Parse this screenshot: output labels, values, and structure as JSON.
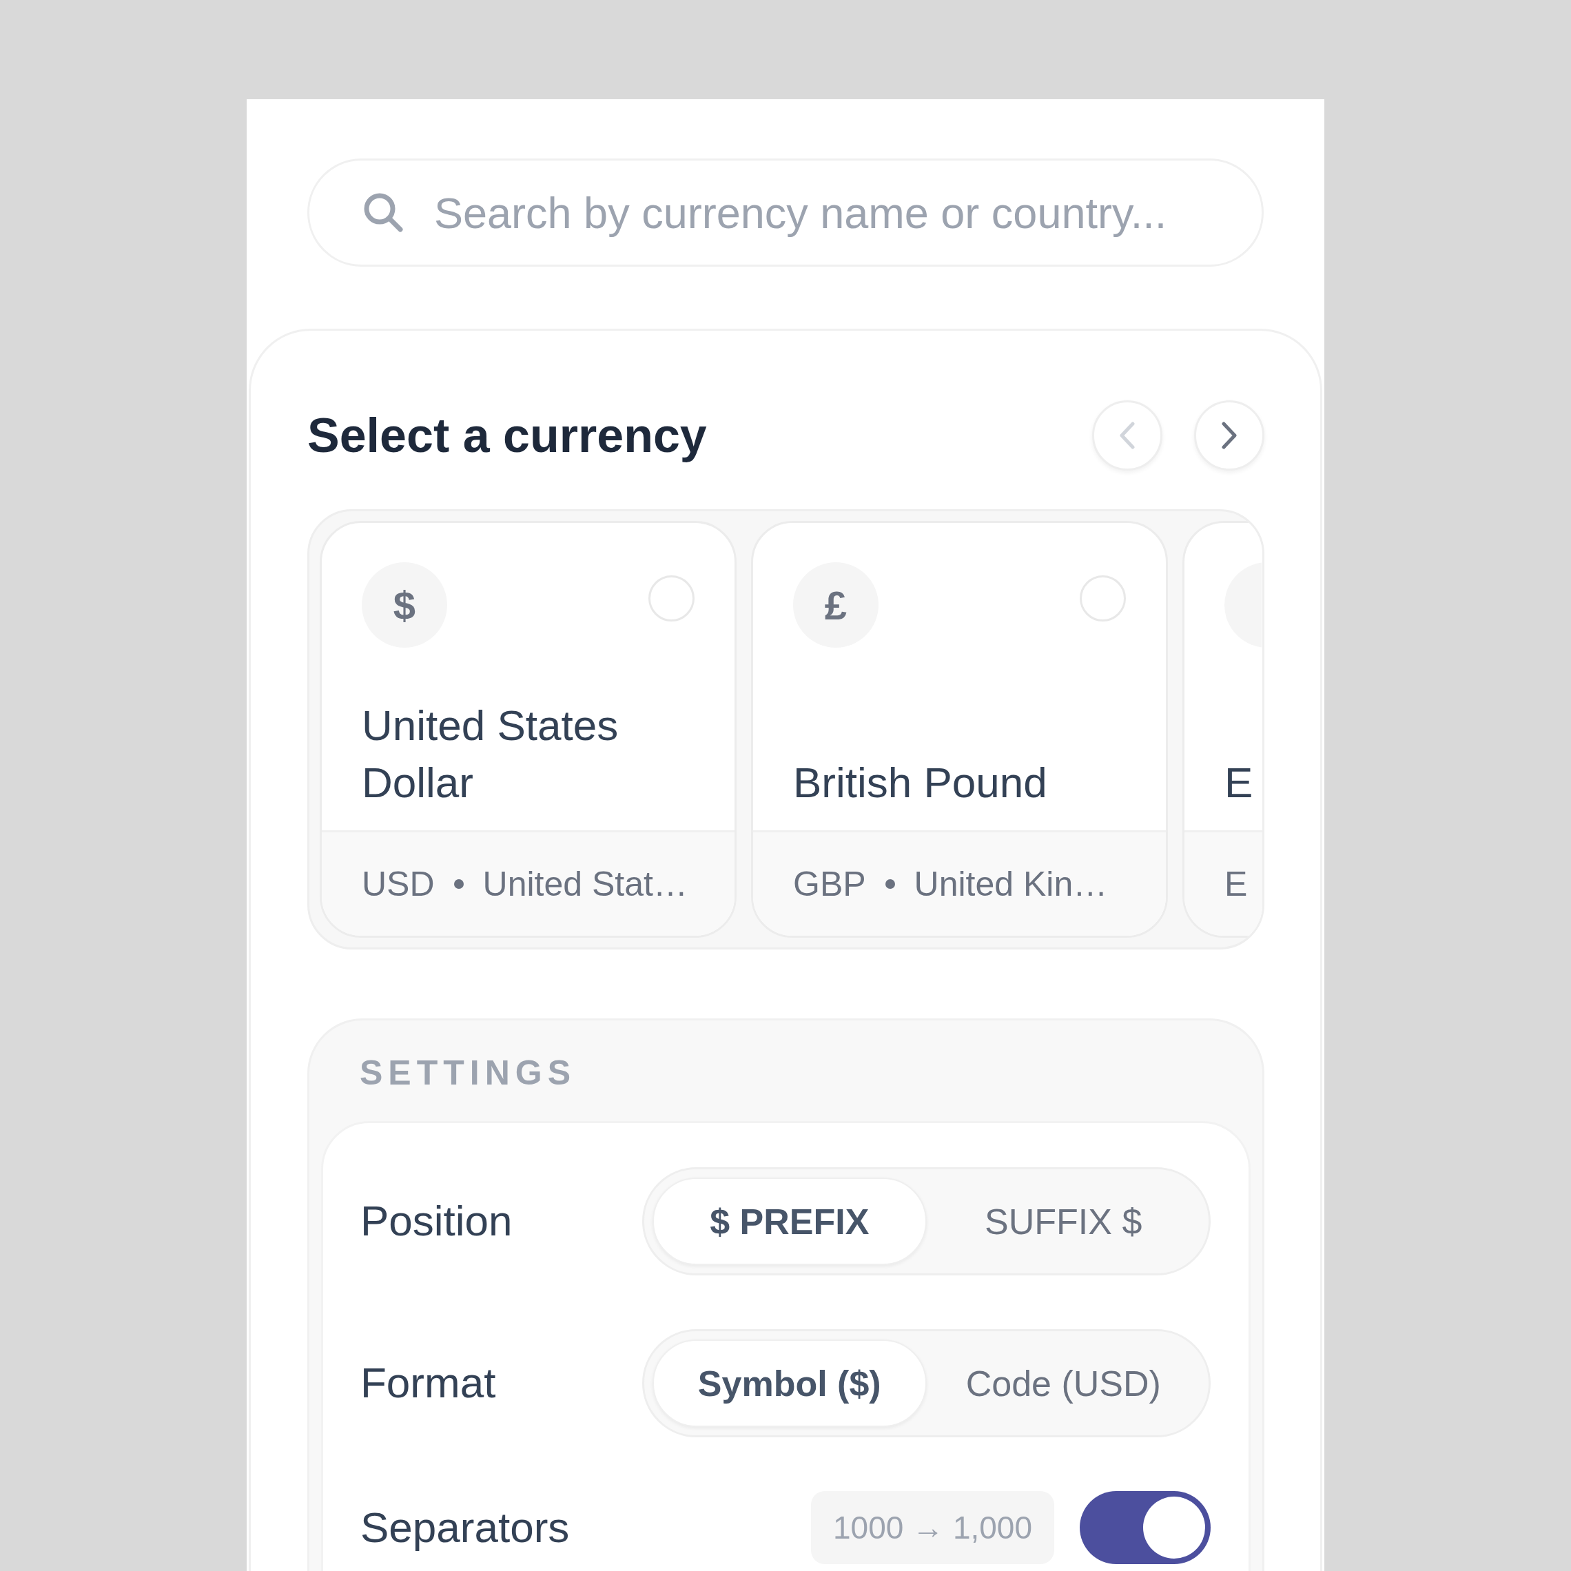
{
  "search": {
    "placeholder": "Search by currency name or country..."
  },
  "currency_picker": {
    "title": "Select a currency",
    "nav": [
      {
        "kind": "prev",
        "disabled": true
      },
      {
        "kind": "next",
        "disabled": false
      }
    ],
    "cards": [
      {
        "kind": "full",
        "symbol": "$",
        "name": "United States Dollar",
        "code": "USD",
        "country": "United Stat…",
        "selected": false
      },
      {
        "kind": "full",
        "symbol": "£",
        "name": "British Pound",
        "code": "GBP",
        "country": "United Kin…",
        "selected": false
      },
      {
        "kind": "partial",
        "name": "E",
        "code": "E"
      }
    ]
  },
  "settings": {
    "title": "SETTINGS",
    "rows": [
      {
        "kind": "segmented",
        "label": "Position",
        "options": [
          {
            "label": "$ PREFIX",
            "selected": true
          },
          {
            "label": "SUFFIX $",
            "selected": false
          }
        ]
      },
      {
        "kind": "segmented",
        "label": "Format",
        "options": [
          {
            "label": "Symbol ($)",
            "selected": true
          },
          {
            "label": "Code (USD)",
            "selected": false
          }
        ]
      },
      {
        "kind": "toggle",
        "label": "Separators",
        "preview": "1000 → 1,000",
        "on": true
      }
    ]
  }
}
